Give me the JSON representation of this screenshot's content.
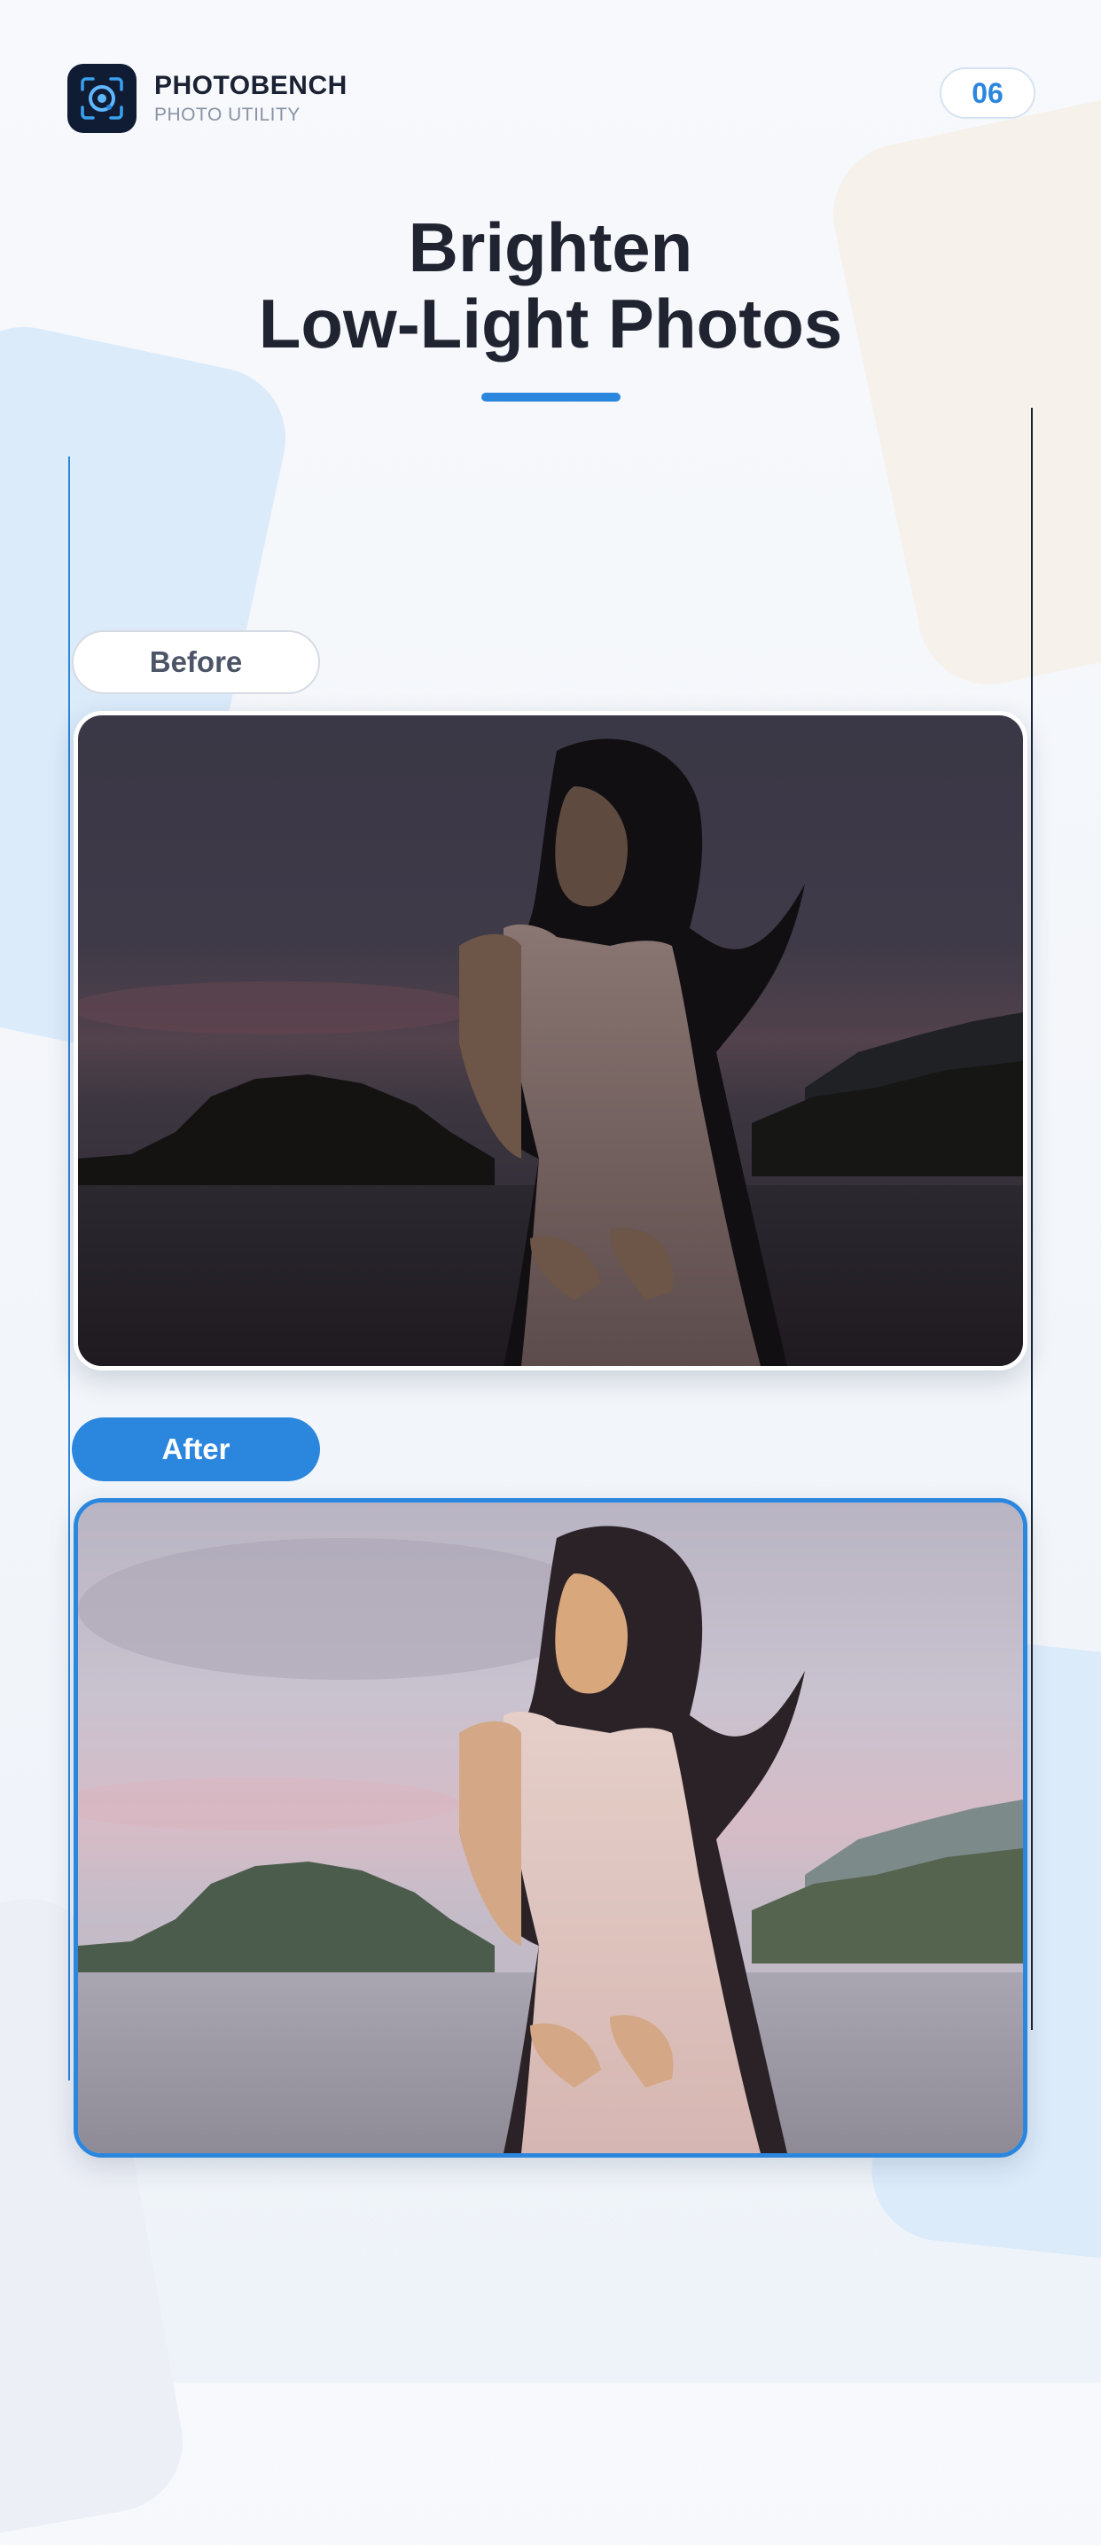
{
  "header": {
    "brand_name": "PHOTOBENCH",
    "brand_subtitle": "PHOTO UTILITY",
    "page_number": "06",
    "app_icon": "photobench-logo-icon"
  },
  "title": {
    "line1": "Brighten",
    "line2": "Low-Light Photos"
  },
  "comparison": {
    "before_label": "Before",
    "after_label": "After"
  },
  "colors": {
    "accent": "#2b86de",
    "dark": "#1f2430",
    "app_icon_bg": "#0f1c33"
  }
}
